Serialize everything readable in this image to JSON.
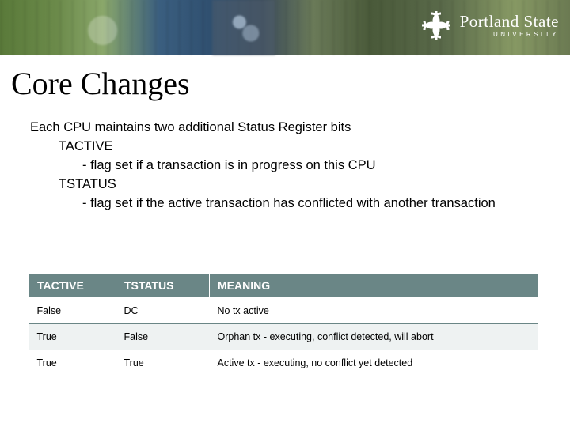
{
  "brand": {
    "name": "Portland State",
    "sub": "UNIVERSITY"
  },
  "title": "Core Changes",
  "body": {
    "line1": "Each CPU maintains two additional Status Register bits",
    "item1": "TACTIVE",
    "item1_desc": "- flag set if a transaction is in progress on this CPU",
    "item2": "TSTATUS",
    "item2_desc": "- flag set if the active transaction has conflicted with another transaction"
  },
  "table": {
    "headers": [
      "TACTIVE",
      "TSTATUS",
      "MEANING"
    ],
    "rows": [
      {
        "tactive": "False",
        "tstatus": "DC",
        "meaning": "No tx active"
      },
      {
        "tactive": "True",
        "tstatus": "False",
        "meaning": "Orphan tx - executing, conflict detected, will abort"
      },
      {
        "tactive": "True",
        "tstatus": "True",
        "meaning": "Active tx - executing, no conflict yet detected"
      }
    ]
  }
}
